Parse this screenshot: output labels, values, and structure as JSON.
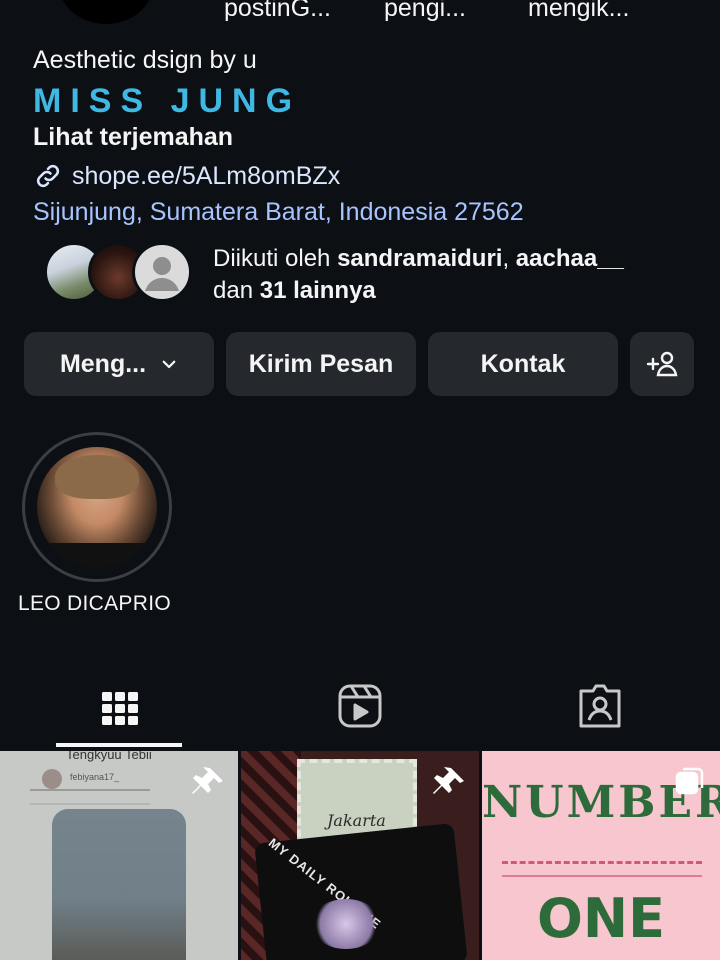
{
  "stats": [
    "postinG...",
    "pengi...",
    "mengik..."
  ],
  "bio": {
    "name_line": "Aesthetic dsign by u",
    "brand": "MISS JUNG",
    "translate": "Lihat terjemahan",
    "link": "shope.ee/5ALm8omBZx",
    "location": "Sijunjung, Sumatera Barat, Indonesia 27562"
  },
  "followed_by": {
    "prefix": "Diikuti oleh ",
    "user1": "sandramaiduri",
    "sep": ", ",
    "user2": "aachaa__",
    "and": ", dan ",
    "others": "31 lainnya"
  },
  "buttons": {
    "follow": "Meng...",
    "message": "Kirim Pesan",
    "contact": "Kontak"
  },
  "highlight": {
    "label": "LEO DICAPRIO"
  },
  "tabs": [
    "grid-icon",
    "reels-icon",
    "tagged-icon"
  ],
  "posts": [
    {
      "caption": "Tengkyuu Tebii",
      "user": "febiyana17_",
      "pinned": true
    },
    {
      "stamp_text": "Jakarta",
      "book_text": "MY DAILY ROUTINE",
      "pinned": true
    },
    {
      "title": "NUMBER",
      "big": "ONE",
      "multi": true
    }
  ],
  "colors": {
    "background": "#0c1014",
    "button": "#25292e",
    "brand": "#3fb8e3",
    "link": "#dbe7ff",
    "location": "#a7c4ff"
  }
}
